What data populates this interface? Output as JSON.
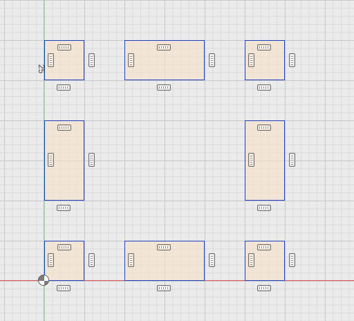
{
  "viewport": {
    "background": "#ebebeb",
    "grid_color": "#c9c9c9",
    "x_axis_color": "#e05555",
    "y_axis_color": "#7ddc7d"
  },
  "sketch": {
    "profile_fill": "#f7e1c8",
    "line_color": "#1e3fc2",
    "constraint_icon": "horizontal-vertical-constraint-icon",
    "dimension_label": "25"
  }
}
